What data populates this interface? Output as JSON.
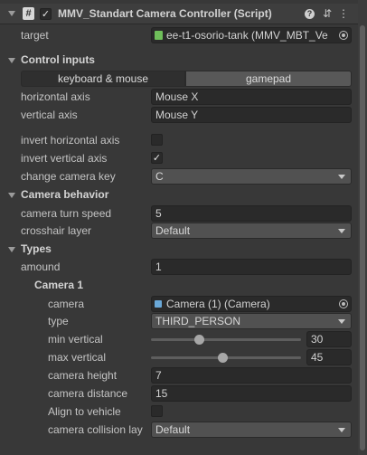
{
  "header": {
    "title": "MMV_Standart Camera Controller (Script)",
    "script_icon_glyph": "#",
    "enabled_check": "✓",
    "settings_glyph": "⇵",
    "menu_glyph": "⋮"
  },
  "target": {
    "label": "target",
    "value": "ee-t1-osorio-tank (MMV_MBT_Ve"
  },
  "control_inputs": {
    "title": "Control inputs",
    "tabs": [
      "keyboard & mouse",
      "gamepad"
    ],
    "selected_tab": "gamepad",
    "horizontal_axis": {
      "label": "horizontal axis",
      "value": "Mouse X"
    },
    "vertical_axis": {
      "label": "vertical axis",
      "value": "Mouse Y"
    },
    "invert_horizontal": {
      "label": "invert horizontal axis",
      "checked": false
    },
    "invert_vertical": {
      "label": "invert vertical axis",
      "checked": true,
      "mark": "✓"
    },
    "change_camera_key": {
      "label": "change camera key",
      "value": "C"
    }
  },
  "camera_behavior": {
    "title": "Camera behavior",
    "turn_speed": {
      "label": "camera turn speed",
      "value": "5"
    },
    "crosshair_layer": {
      "label": "crosshair layer",
      "value": "Default"
    }
  },
  "types": {
    "title": "Types",
    "amount": {
      "label": "amound",
      "value": "1"
    },
    "camera1": {
      "title": "Camera 1",
      "camera": {
        "label": "camera",
        "value": "Camera (1) (Camera)"
      },
      "type": {
        "label": "type",
        "value": "THIRD_PERSON"
      },
      "min_vertical": {
        "label": "min vertical",
        "value": "30",
        "slider_fraction": 0.32
      },
      "max_vertical": {
        "label": "max vertical",
        "value": "45",
        "slider_fraction": 0.48
      },
      "camera_height": {
        "label": "camera height",
        "value": "7"
      },
      "camera_distance": {
        "label": "camera distance",
        "value": "15"
      },
      "align_to_vehicle": {
        "label": "Align to vehicle",
        "checked": false
      },
      "collision_layer": {
        "label": "camera collision lay",
        "value": "Default"
      }
    }
  },
  "colors": {
    "background": "#383838",
    "field": "#2a2a2a",
    "dropdown": "#515151",
    "tab_selected": "#585858",
    "target_icon": "#6fbf5a",
    "camera_icon": "#6aa8d8"
  }
}
